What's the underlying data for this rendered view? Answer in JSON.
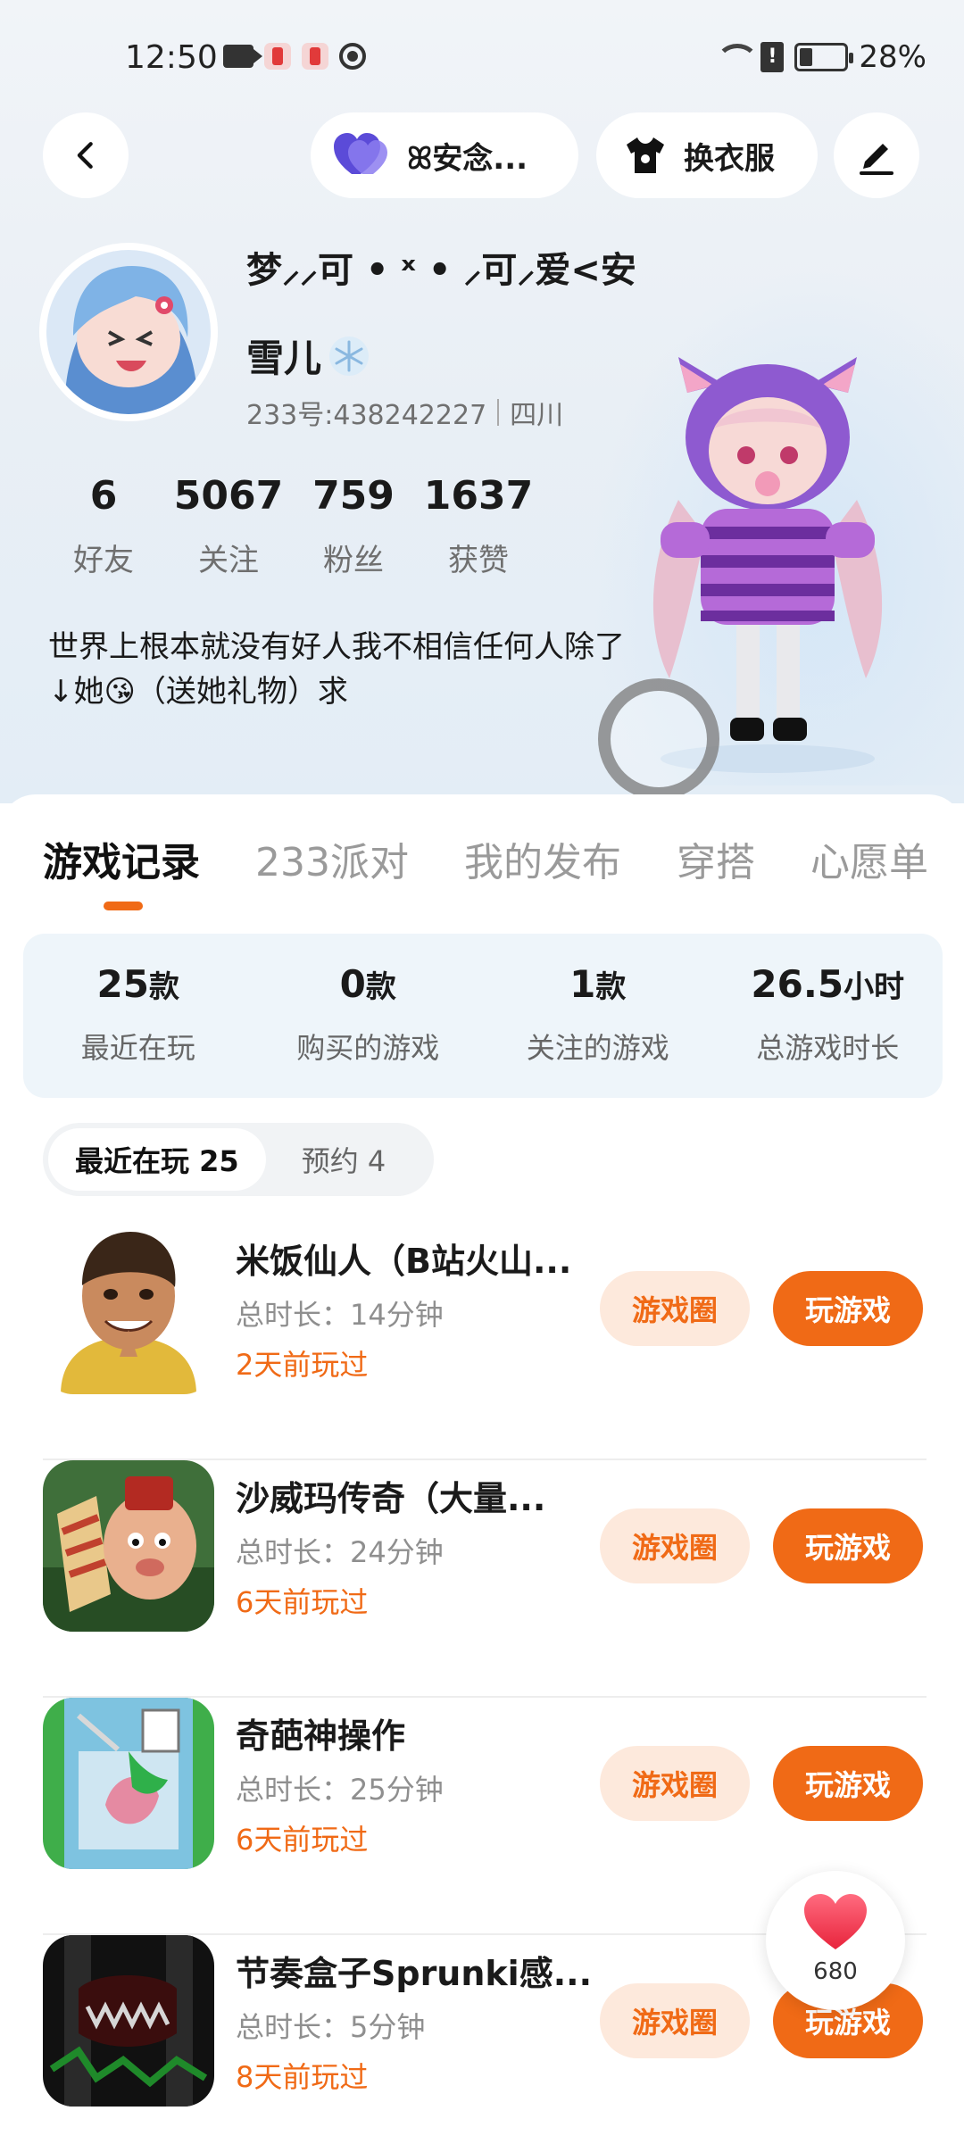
{
  "status_bar": {
    "time": "12:50",
    "sim_label": "!",
    "battery": "28%"
  },
  "top_nav": {
    "cp_label": "ꕤ安念...",
    "dress_label": "换衣服"
  },
  "profile": {
    "signature_name": "梦⸝⸝可 • ˣ • ⸝可⸝爱<安",
    "nickname": "雪儿",
    "user_id": "233号:438242227",
    "location": "四川",
    "bio": "世界上根本就没有好人我不相信任何人除了↓她😘（送她礼物）求"
  },
  "stats": [
    {
      "value": "6",
      "label": "好友"
    },
    {
      "value": "5067",
      "label": "关注"
    },
    {
      "value": "759",
      "label": "粉丝"
    },
    {
      "value": "1637",
      "label": "获赞"
    }
  ],
  "tabs": [
    {
      "label": "游戏记录"
    },
    {
      "label": "233派对"
    },
    {
      "label": "我的发布"
    },
    {
      "label": "穿搭"
    },
    {
      "label": "心愿单"
    }
  ],
  "summary": [
    {
      "value": "25",
      "unit": "款",
      "label": "最近在玩"
    },
    {
      "value": "0",
      "unit": "款",
      "label": "购买的游戏"
    },
    {
      "value": "1",
      "unit": "款",
      "label": "关注的游戏"
    },
    {
      "value": "26.5",
      "unit": "小时",
      "label": "总游戏时长"
    }
  ],
  "subtabs": {
    "recent": "最近在玩 25",
    "reserve": "预约 4"
  },
  "games": [
    {
      "title": "米饭仙人（B站火山...",
      "duration": "总时长：14分钟",
      "last_played": "2天前玩过",
      "circle_label": "游戏圈",
      "play_label": "玩游戏"
    },
    {
      "title": "沙威玛传奇（大量...",
      "duration": "总时长：24分钟",
      "last_played": "6天前玩过",
      "circle_label": "游戏圈",
      "play_label": "玩游戏"
    },
    {
      "title": "奇葩神操作",
      "duration": "总时长：25分钟",
      "last_played": "6天前玩过",
      "circle_label": "游戏圈",
      "play_label": "玩游戏"
    },
    {
      "title": "节奏盒子Sprunki感...",
      "duration": "总时长：5分钟",
      "last_played": "8天前玩过",
      "circle_label": "游戏圈",
      "play_label": "玩游戏"
    }
  ],
  "like_fab": {
    "count": "680"
  },
  "colors": {
    "accent": "#f06a16",
    "accent_light": "#fde9dc",
    "summary_bg": "#eef5fa"
  }
}
